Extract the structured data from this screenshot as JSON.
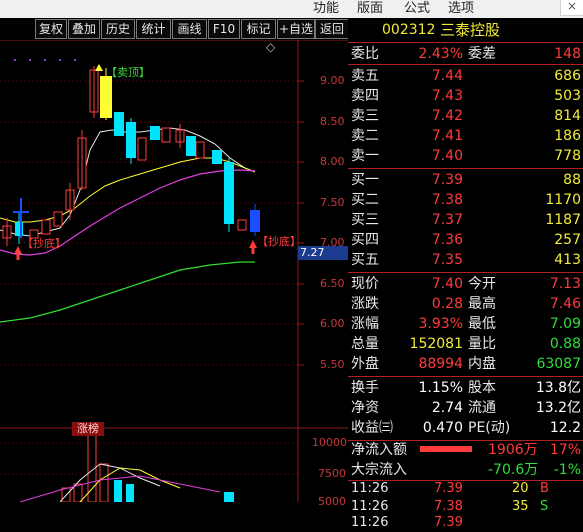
{
  "menu": {
    "items": [
      "功能",
      "版面",
      "公式",
      "选项"
    ],
    "close_btn": "×"
  },
  "toolbar": {
    "buttons": [
      "复权",
      "叠加",
      "历史",
      "统计",
      "画线",
      "F10",
      "标记",
      "+自选",
      "返回"
    ]
  },
  "chart": {
    "price_labels": [
      "9.00",
      "8.50",
      "8.00",
      "7.50",
      "7.00",
      "6.50",
      "6.00",
      "5.50"
    ],
    "volume_labels": [
      "10000",
      "7500",
      "5000"
    ],
    "current_price_marker": "7.27",
    "signal_top": "【卖顶】",
    "signal_bottom_left": "【抄底】",
    "signal_bottom_right": "【抄底】",
    "limit_up_tag": "涨榜",
    "diamond": "◇",
    "colors": {
      "up": "#ff3b3b",
      "down": "#00e4ff",
      "ma_white": "#e6e6e6",
      "ma_yellow": "#ffff33",
      "ma_magenta": "#e040e0",
      "ma_green": "#33dd33"
    }
  },
  "stock": {
    "code": "002312",
    "name": "三泰控股"
  },
  "quote": {
    "weibi_label": "委比",
    "weibi": "2.43%",
    "weicha_label": "委差",
    "weicha": "148",
    "asks": [
      {
        "label": "卖五",
        "price": "7.44",
        "vol": "686"
      },
      {
        "label": "卖四",
        "price": "7.43",
        "vol": "503"
      },
      {
        "label": "卖三",
        "price": "7.42",
        "vol": "814"
      },
      {
        "label": "卖二",
        "price": "7.41",
        "vol": "186"
      },
      {
        "label": "卖一",
        "price": "7.40",
        "vol": "778"
      }
    ],
    "bids": [
      {
        "label": "买一",
        "price": "7.39",
        "vol": "88"
      },
      {
        "label": "买二",
        "price": "7.38",
        "vol": "1170"
      },
      {
        "label": "买三",
        "price": "7.37",
        "vol": "1187"
      },
      {
        "label": "买四",
        "price": "7.36",
        "vol": "257"
      },
      {
        "label": "买五",
        "price": "7.35",
        "vol": "413"
      }
    ],
    "stats": [
      {
        "l1": "现价",
        "v1": "7.40",
        "c1": "red",
        "l2": "今开",
        "v2": "7.13",
        "c2": "red"
      },
      {
        "l1": "涨跌",
        "v1": "0.28",
        "c1": "red",
        "l2": "最高",
        "v2": "7.46",
        "c2": "red"
      },
      {
        "l1": "涨幅",
        "v1": "3.93%",
        "c1": "red",
        "l2": "最低",
        "v2": "7.09",
        "c2": "green"
      },
      {
        "l1": "总量",
        "v1": "152081",
        "c1": "yellow",
        "l2": "量比",
        "v2": "0.88",
        "c2": "green"
      },
      {
        "l1": "外盘",
        "v1": "88994",
        "c1": "red",
        "l2": "内盘",
        "v2": "63087",
        "c2": "green"
      }
    ],
    "stats2": [
      {
        "l1": "换手",
        "v1": "1.15%",
        "c1": "white",
        "l2": "股本",
        "v2": "13.8亿",
        "c2": "white"
      },
      {
        "l1": "净资",
        "v1": "2.74",
        "c1": "white",
        "l2": "流通",
        "v2": "13.2亿",
        "c2": "white"
      },
      {
        "l1": "收益㈢",
        "v1": "0.470",
        "c1": "white",
        "l2": "PE(动)",
        "v2": "12.2",
        "c2": "white"
      }
    ],
    "flow": [
      {
        "label": "净流入额",
        "value": "1906万",
        "pct": "17%",
        "color": "red"
      },
      {
        "label": "大宗流入",
        "value": "-70.6万",
        "pct": "-1%",
        "color": "green"
      }
    ],
    "ticks": [
      {
        "time": "11:26",
        "price": "7.39",
        "vol": "20",
        "side": "B"
      },
      {
        "time": "11:26",
        "price": "7.38",
        "vol": "35",
        "side": "S"
      },
      {
        "time": "11:26",
        "price": "7.39",
        "vol": "",
        "side": ""
      }
    ]
  }
}
